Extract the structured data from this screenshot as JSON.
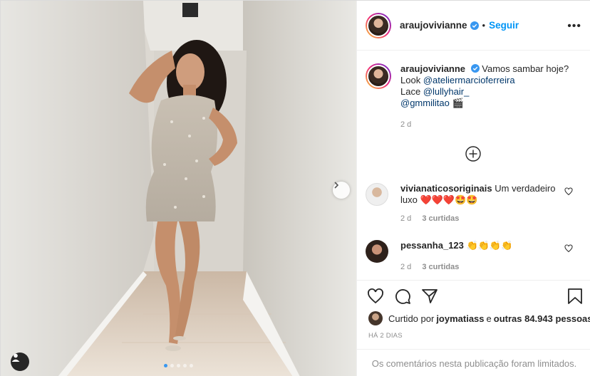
{
  "post": {
    "username": "araujovivianne",
    "follow_label": "Seguir",
    "separator": "•",
    "more_label": "•••"
  },
  "caption": {
    "username": "araujovivianne",
    "text": "Vamos sambar hoje?",
    "look_prefix": "Look ",
    "look_mention": "@ateliermarcioferreira",
    "lace_prefix": "Lace ",
    "lace_mention": "@lullyhair_",
    "final_mention": "@gmmilitao",
    "emoji": "🎬",
    "time": "2 d"
  },
  "comments": [
    {
      "username": "vivianaticosoriginais",
      "text": "Um verdadeiro luxo ❤️❤️❤️🤩🤩",
      "time": "2 d",
      "replies": "3 curtidas"
    },
    {
      "username": "pessanha_123",
      "text": "👏👏👏👏",
      "time": "2 d",
      "replies": "3 curtidas"
    }
  ],
  "likes": {
    "prefix": "Curtido por ",
    "user": "joymatiass",
    "middle": " e ",
    "others": "outras 84.943 pessoas"
  },
  "date_label": "HÁ 2 DIAS",
  "comments_limited": "Os comentários nesta publicação foram limitados.",
  "carousel": {
    "current_index": 1,
    "total": 5
  },
  "colors": {
    "link": "#0095f6",
    "mention": "#00376b",
    "muted": "#8e8e8e",
    "active_dot": "#3897f0"
  },
  "icons": [
    "verified-badge-icon",
    "more-options-icon",
    "chevron-right-icon",
    "user-tag-icon",
    "plus-circle-icon",
    "heart-icon",
    "comment-icon",
    "share-icon",
    "bookmark-icon"
  ]
}
